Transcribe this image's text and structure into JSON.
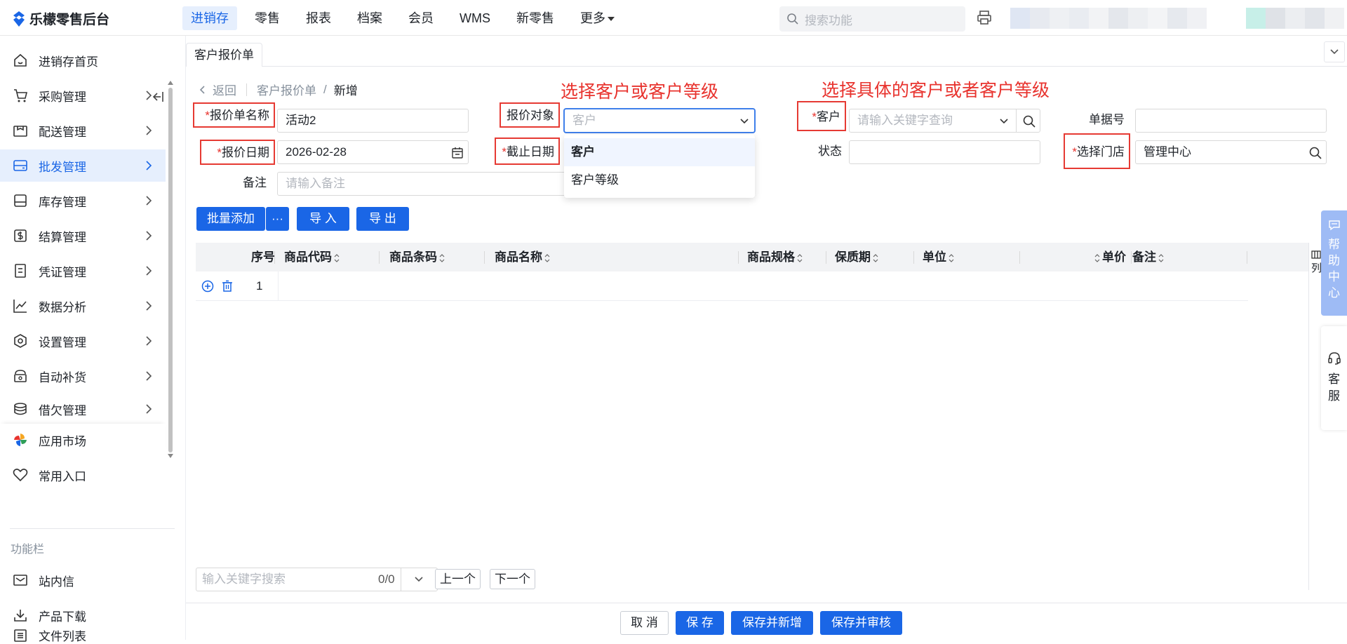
{
  "app": {
    "logo_text": "乐檬零售后台"
  },
  "topnav": [
    {
      "label": "进销存",
      "active": true
    },
    {
      "label": "零售"
    },
    {
      "label": "报表"
    },
    {
      "label": "档案"
    },
    {
      "label": "会员"
    },
    {
      "label": "WMS"
    },
    {
      "label": "新零售"
    },
    {
      "label": "更多"
    }
  ],
  "top_search": {
    "placeholder": "搜索功能"
  },
  "sidebar": {
    "items": [
      {
        "label": "进销存首页",
        "icon": "home-icon"
      },
      {
        "label": "采购管理",
        "icon": "cart-icon"
      },
      {
        "label": "配送管理",
        "icon": "delivery-icon"
      },
      {
        "label": "批发管理",
        "icon": "wholesale-icon",
        "active": true
      },
      {
        "label": "库存管理",
        "icon": "inventory-icon"
      },
      {
        "label": "结算管理",
        "icon": "settlement-icon"
      },
      {
        "label": "凭证管理",
        "icon": "voucher-icon"
      },
      {
        "label": "数据分析",
        "icon": "chart-icon"
      },
      {
        "label": "设置管理",
        "icon": "settings-icon"
      },
      {
        "label": "自动补货",
        "icon": "replenish-icon"
      },
      {
        "label": "借欠管理",
        "icon": "debt-icon"
      }
    ],
    "extra_items": [
      {
        "label": "应用市场",
        "icon": "app-market-icon"
      },
      {
        "label": "常用入口",
        "icon": "heart-icon"
      }
    ],
    "section_title": "功能栏",
    "tool_items": [
      {
        "label": "站内信",
        "icon": "mail-icon"
      },
      {
        "label": "产品下载",
        "icon": "download-icon"
      },
      {
        "label": "文件列表",
        "icon": "file-list-icon"
      }
    ]
  },
  "tab": {
    "label": "客户报价单"
  },
  "breadcrumb": {
    "back": "返回",
    "parent": "客户报价单",
    "sep": "/",
    "current": "新增"
  },
  "annotations": {
    "left": "选择客户或客户等级",
    "right": "选择具体的客户或者客户等级"
  },
  "form": {
    "name": {
      "label": "报价单名称",
      "value": "活动2"
    },
    "target": {
      "label": "报价对象",
      "placeholder": "客户"
    },
    "customer": {
      "label": "客户",
      "placeholder": "请输入关键字查询"
    },
    "doc_no": {
      "label": "单据号",
      "value": ""
    },
    "date": {
      "label": "报价日期",
      "value": "2026-02-28"
    },
    "end_date": {
      "label": "截止日期"
    },
    "status": {
      "label": "状态",
      "value": ""
    },
    "store": {
      "label": "选择门店",
      "value": "管理中心"
    },
    "remark": {
      "label": "备注",
      "placeholder": "请输入备注"
    },
    "required_mark": "*"
  },
  "dropdown": {
    "options": [
      {
        "label": "客户",
        "selected": true
      },
      {
        "label": "客户等级"
      }
    ]
  },
  "toolbar": {
    "batch_add": "批量添加",
    "more": "···",
    "import": "导 入",
    "export": "导 出"
  },
  "table": {
    "columns": [
      "序号",
      "商品代码",
      "商品条码",
      "商品名称",
      "商品规格",
      "保质期",
      "单位",
      "单价",
      "备注"
    ],
    "rows": [
      {
        "seq": "1"
      }
    ],
    "col_settings": "列"
  },
  "side_widgets": {
    "help": "帮助中心",
    "service": "客服"
  },
  "find": {
    "placeholder": "输入关键字搜索",
    "count": "0/0",
    "prev": "上一个",
    "next": "下一个"
  },
  "footer": {
    "cancel": "取 消",
    "save": "保 存",
    "save_new": "保存并新增",
    "save_audit": "保存并审核"
  },
  "colors": {
    "primary": "#1a66e6",
    "annotation": "#e8332e",
    "active_bg": "#e6effd"
  }
}
